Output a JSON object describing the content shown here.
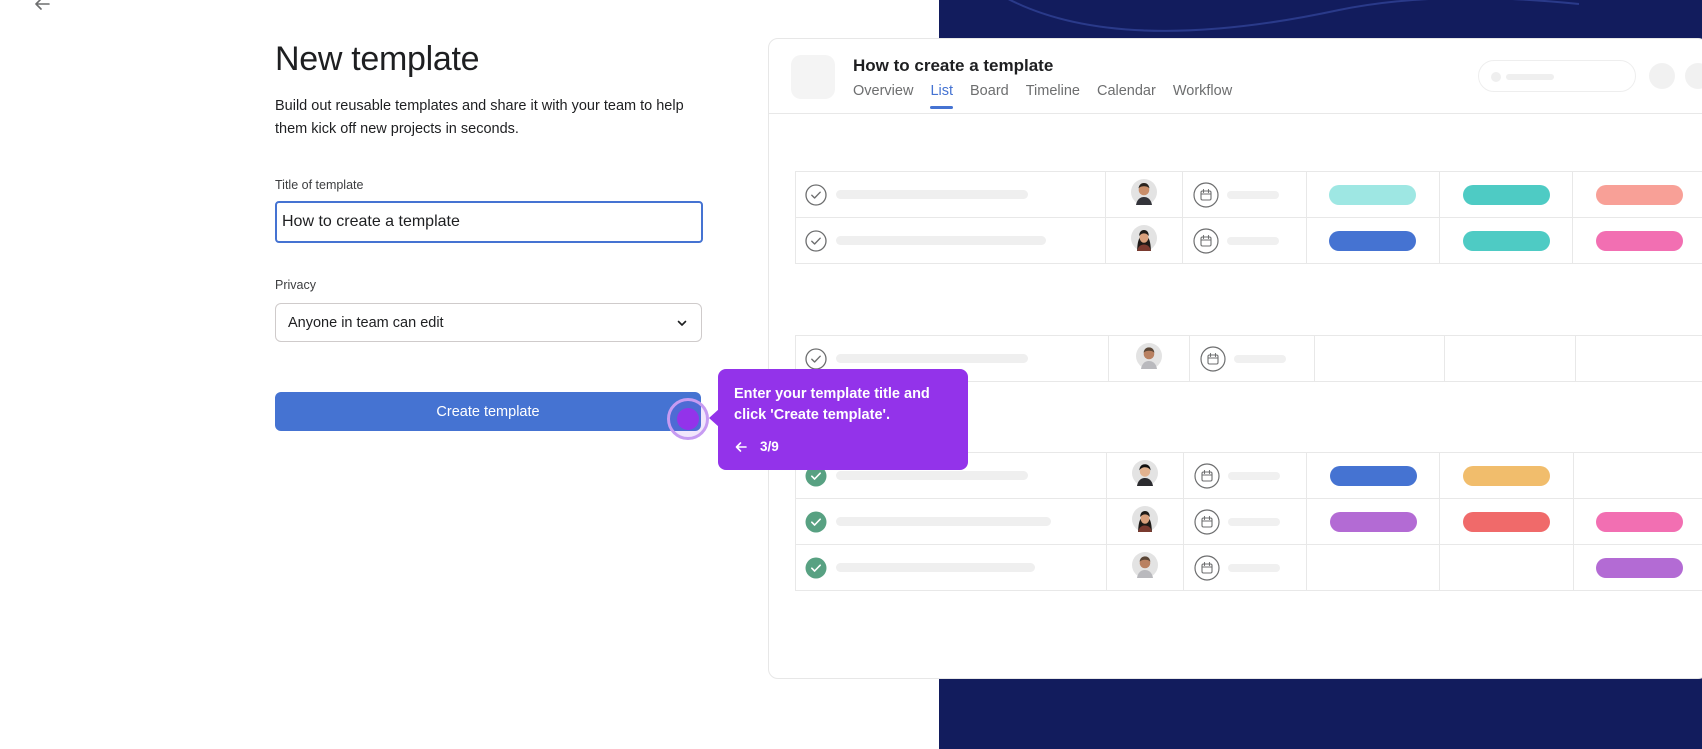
{
  "form": {
    "heading": "New template",
    "description": "Build out reusable templates and share it with your team to help them kick off new projects in seconds.",
    "title_label": "Title of template",
    "title_value": "How to create a template",
    "privacy_label": "Privacy",
    "privacy_value": "Anyone in team can edit",
    "create_button_label": "Create template"
  },
  "preview": {
    "project_title": "How to create a template",
    "tabs": [
      {
        "label": "Overview",
        "active": false
      },
      {
        "label": "List",
        "active": true
      },
      {
        "label": "Board",
        "active": false
      },
      {
        "label": "Timeline",
        "active": false
      },
      {
        "label": "Calendar",
        "active": false
      },
      {
        "label": "Workflow",
        "active": false
      }
    ]
  },
  "tooltip": {
    "text": "Enter your template title and click 'Create template'.",
    "step": "3/9"
  },
  "colors": {
    "accent": "#4573d2",
    "tooltip": "#9333ea",
    "navy": "#121c5d",
    "done_check": "#58a182",
    "pills": {
      "light_teal": "#9ee7e3",
      "teal": "#4ecbc4",
      "blue": "#4573d2",
      "salmon": "#f8a097",
      "pink": "#f26fb2",
      "yellow": "#f1bd6c",
      "red": "#f06a6a",
      "purple": "#b36bd4"
    }
  },
  "icons": {
    "back": "arrow-left-icon",
    "dropdown": "chevron-down-icon",
    "task_check": "check-circle-icon",
    "due_date": "calendar-icon",
    "tooltip_back": "arrow-left-icon"
  }
}
